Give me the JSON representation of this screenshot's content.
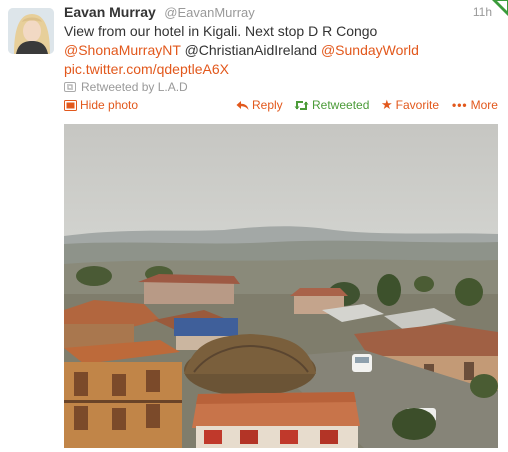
{
  "tweet": {
    "name": "Eavan Murray",
    "handle": "@EavanMurray",
    "time": "11h",
    "text": {
      "line1": "View from our hotel in Kigali. Next stop D R Congo",
      "mention1": "@ShonaMurrayNT",
      "mention2": "@ChristianAidIreland",
      "mention3": "@SundayWorld",
      "link": "pic.twitter.com/qdeptleA6X"
    },
    "retweeted_by": "Retweeted by L.A.D"
  },
  "actions": {
    "hide_photo": "Hide photo",
    "reply": "Reply",
    "retweeted": "Retweeted",
    "favorite": "Favorite",
    "more": "More"
  },
  "colors": {
    "link": "#e2581c",
    "retweeted": "#4b9b38",
    "muted": "#999999",
    "corner_flag": "#3b9b3b"
  },
  "icons": {
    "hide_photo": "photo-icon",
    "reply": "reply-arrow-icon",
    "retweeted": "retweet-icon",
    "favorite": "star-icon",
    "more": "ellipsis-icon",
    "retweeted_by": "retweet-small-icon"
  }
}
